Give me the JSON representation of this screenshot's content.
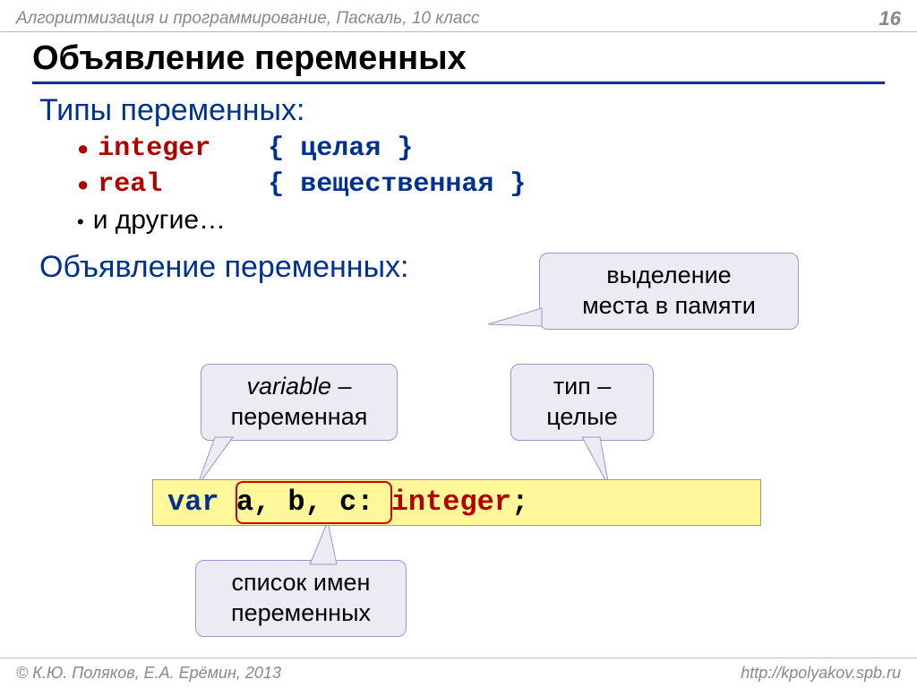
{
  "header": {
    "course": "Алгоритмизация и программирование, Паскаль, 10 класс",
    "page": "16"
  },
  "title": "Объявление переменных",
  "types_heading": "Типы переменных:",
  "types": [
    {
      "keyword": "integer",
      "comment": "{ целая }"
    },
    {
      "keyword": "real",
      "comment": "{ вещественная }"
    }
  ],
  "others_label": "и другие…",
  "decl_heading": "Объявление переменных:",
  "callouts": {
    "memory": "выделение\nместа в памяти",
    "variable_line1": "variable –",
    "variable_line2": "переменная",
    "type": "тип –\nцелые",
    "varlist": "список имен\nпеременных"
  },
  "code": {
    "var_kw": "var",
    "vars": "a, b, c",
    "colon": ":",
    "type_kw": "integer",
    "semi": ";"
  },
  "footer": {
    "author": "К.Ю. Поляков, Е.А. Ерёмин, 2013",
    "url": "http://kpolyakov.spb.ru"
  }
}
